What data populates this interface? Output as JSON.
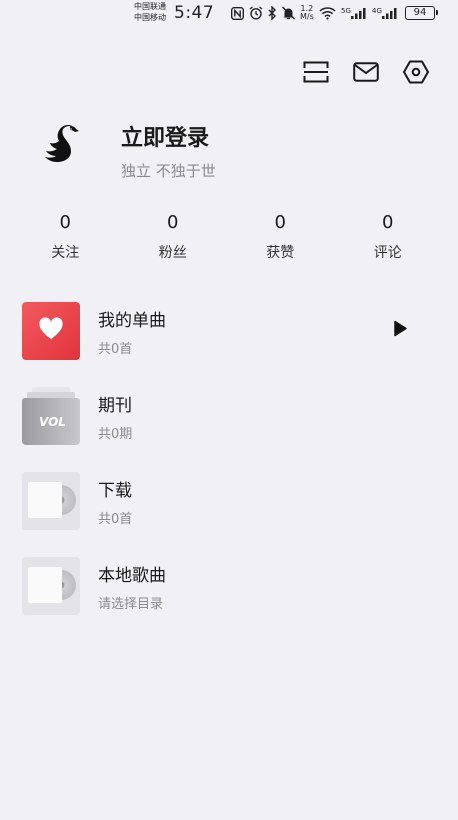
{
  "status_bar": {
    "carrier1": "中国联通",
    "carrier2": "中国移动",
    "time": "5:47",
    "net_speed_value": "1.2",
    "net_speed_unit": "M/s",
    "battery": "94",
    "icons": [
      "nfc-icon",
      "alarm-icon",
      "bluetooth-icon",
      "mute-icon",
      "wifi-icon",
      "signal-5g-icon",
      "signal-4g-icon"
    ]
  },
  "top_actions": {
    "icons": [
      "scan-icon",
      "mail-icon",
      "settings-icon"
    ]
  },
  "profile": {
    "login_label": "立即登录",
    "slogan": "独立 不独于世",
    "avatar_icon": "swan-logo"
  },
  "stats": [
    {
      "value": "0",
      "label": "关注"
    },
    {
      "value": "0",
      "label": "粉丝"
    },
    {
      "value": "0",
      "label": "获赞"
    },
    {
      "value": "0",
      "label": "评论"
    }
  ],
  "library": [
    {
      "title": "我的单曲",
      "subtitle": "共0首",
      "icon": "heart-icon"
    },
    {
      "title": "期刊",
      "subtitle": "共0期",
      "badge": "VOL"
    },
    {
      "title": "下载",
      "subtitle": "共0首",
      "icon": "disc-icon"
    },
    {
      "title": "本地歌曲",
      "subtitle": "请选择目录",
      "icon": "disc-icon"
    }
  ],
  "colors": {
    "background": "#f0f0f5",
    "accent_red": "#e83a41",
    "muted_text": "#8a8a8f"
  }
}
